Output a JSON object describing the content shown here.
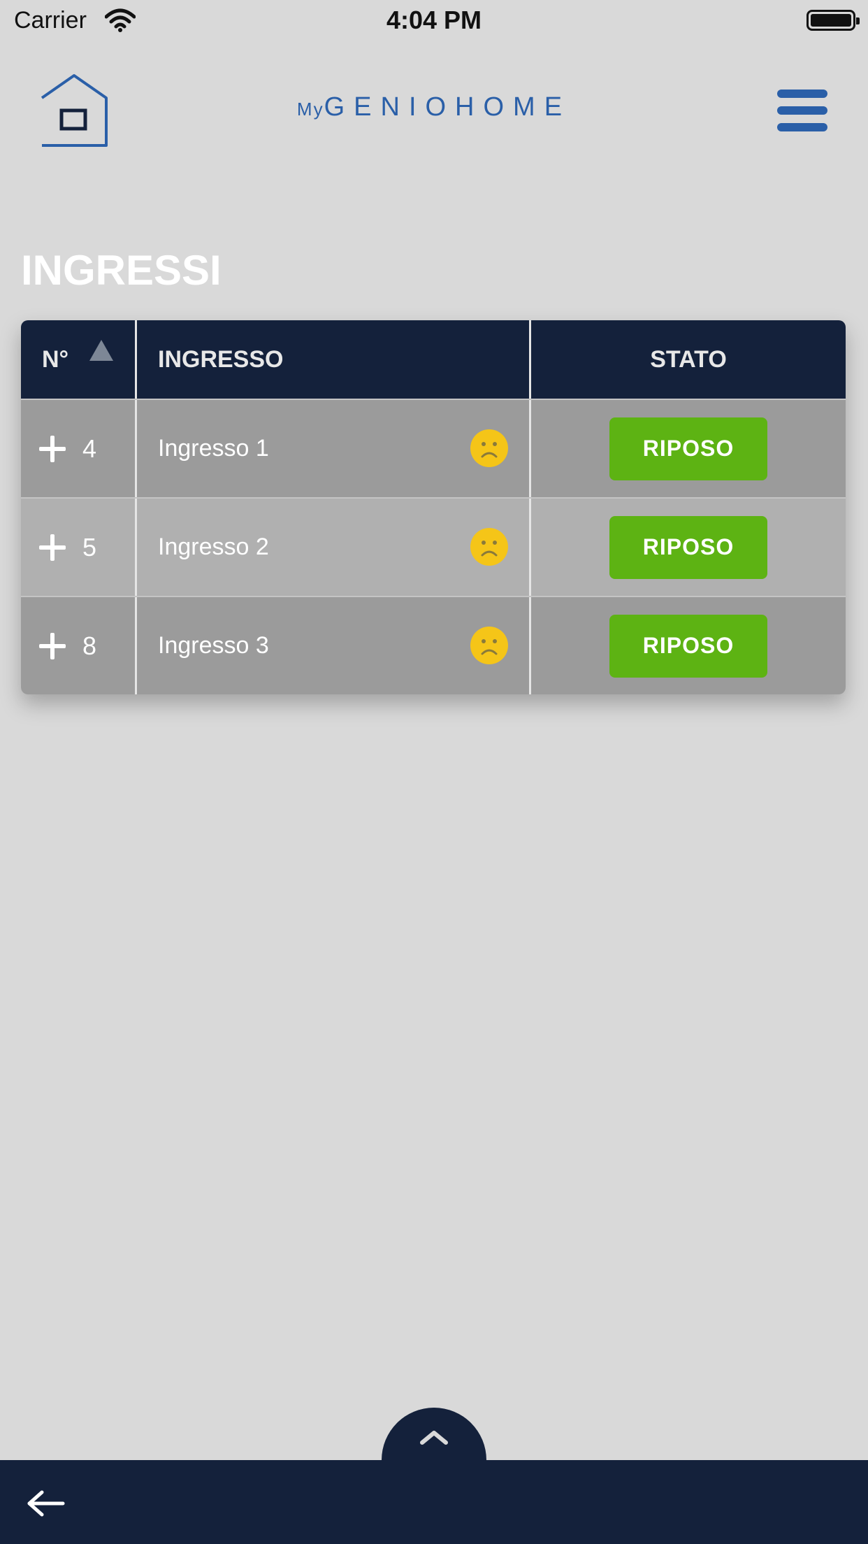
{
  "status_bar": {
    "carrier": "Carrier",
    "time": "4:04 PM"
  },
  "header": {
    "brand_prefix": "My",
    "brand_name": "GENIOHOME"
  },
  "page": {
    "title": "INGRESSI"
  },
  "table": {
    "columns": [
      "N°",
      "INGRESSO",
      "STATO"
    ],
    "sort_column": "N°",
    "sort_direction": "ascending",
    "rows": [
      {
        "number": "4",
        "name": "Ingresso 1",
        "status_icon": "sad-face-icon",
        "state": "RIPOSO"
      },
      {
        "number": "5",
        "name": "Ingresso 2",
        "status_icon": "sad-face-icon",
        "state": "RIPOSO"
      },
      {
        "number": "8",
        "name": "Ingresso 3",
        "status_icon": "sad-face-icon",
        "state": "RIPOSO"
      }
    ]
  },
  "colors": {
    "background": "#d9d9d9",
    "header_navy": "#14213b",
    "brand_blue": "#2a5fa8",
    "state_green": "#5db313",
    "face_yellow": "#f5c518"
  }
}
